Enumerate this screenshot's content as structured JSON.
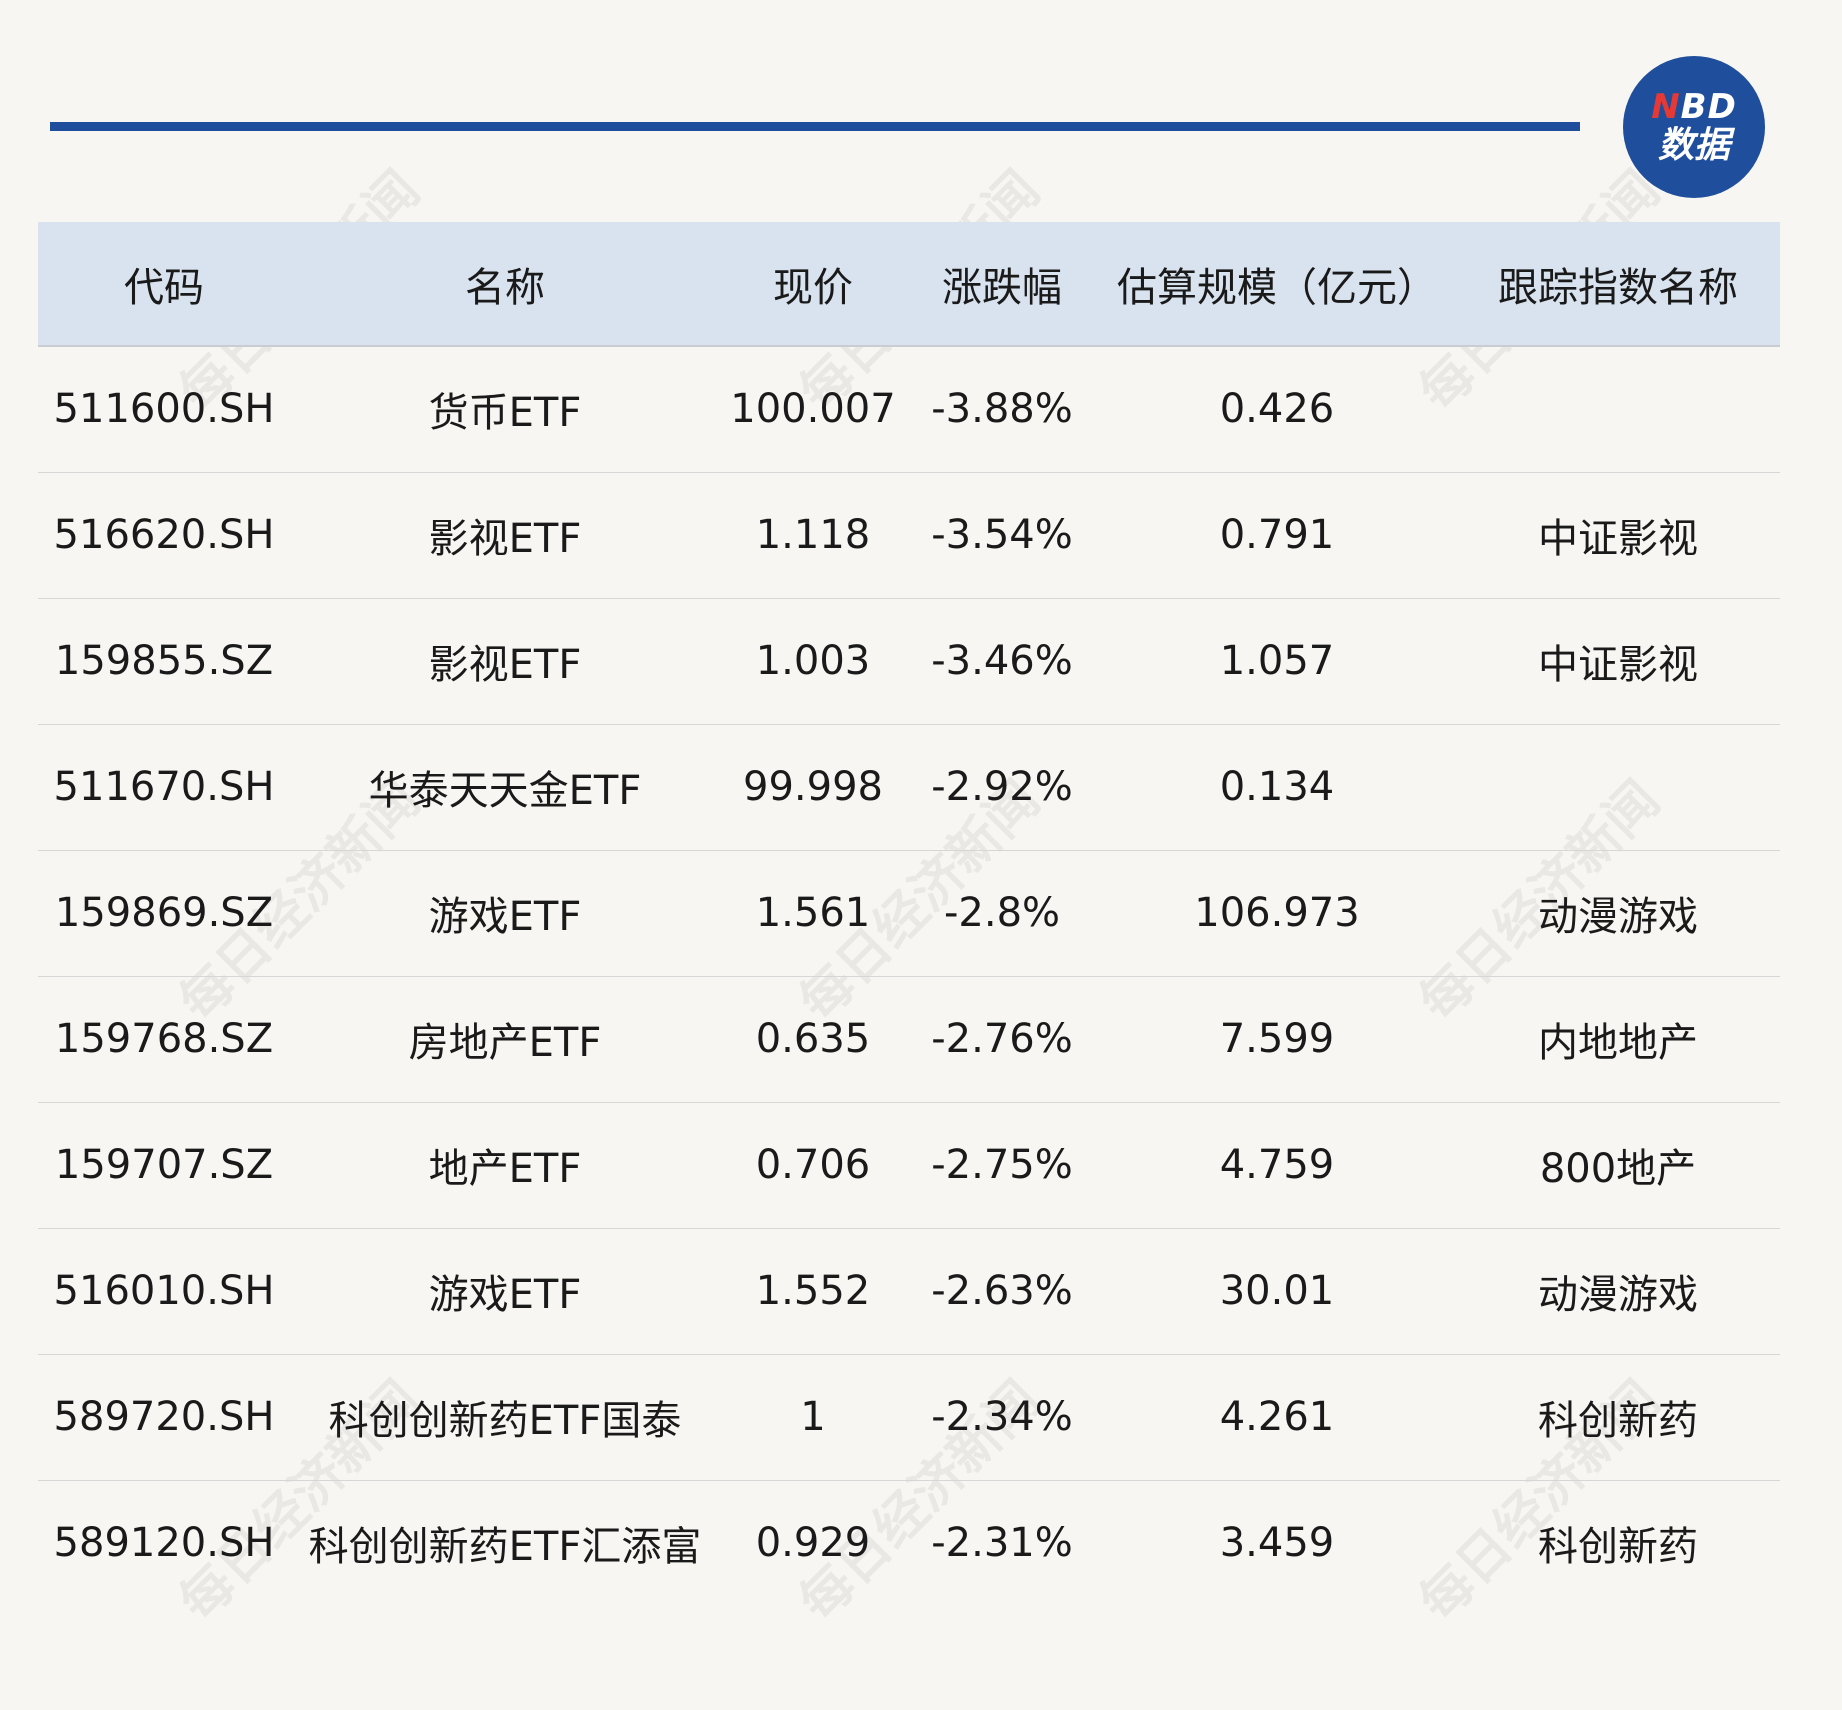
{
  "logo": {
    "top_n": "N",
    "top_rest": "BD",
    "bottom": "数据"
  },
  "watermark_text": "每日经济新闻",
  "colors": {
    "accent": "#1f4e9c",
    "header_bg": "#d8e3ef",
    "page_bg": "#f8f6f2",
    "logo_red": "#e53935"
  },
  "chart_data": {
    "type": "table",
    "columns": [
      "代码",
      "名称",
      "现价",
      "涨跌幅",
      "估算规模（亿元）",
      "跟踪指数名称"
    ],
    "rows": [
      [
        "511600.SH",
        "货币ETF",
        "100.007",
        "-3.88%",
        "0.426",
        ""
      ],
      [
        "516620.SH",
        "影视ETF",
        "1.118",
        "-3.54%",
        "0.791",
        "中证影视"
      ],
      [
        "159855.SZ",
        "影视ETF",
        "1.003",
        "-3.46%",
        "1.057",
        "中证影视"
      ],
      [
        "511670.SH",
        "华泰天天金ETF",
        "99.998",
        "-2.92%",
        "0.134",
        ""
      ],
      [
        "159869.SZ",
        "游戏ETF",
        "1.561",
        "-2.8%",
        "106.973",
        "动漫游戏"
      ],
      [
        "159768.SZ",
        "房地产ETF",
        "0.635",
        "-2.76%",
        "7.599",
        "内地地产"
      ],
      [
        "159707.SZ",
        "地产ETF",
        "0.706",
        "-2.75%",
        "4.759",
        "800地产"
      ],
      [
        "516010.SH",
        "游戏ETF",
        "1.552",
        "-2.63%",
        "30.01",
        "动漫游戏"
      ],
      [
        "589720.SH",
        "科创创新药ETF国泰",
        "1",
        "-2.34%",
        "4.261",
        "科创新药"
      ],
      [
        "589120.SH",
        "科创创新药ETF汇添富",
        "0.929",
        "-2.31%",
        "3.459",
        "科创新药"
      ]
    ]
  }
}
